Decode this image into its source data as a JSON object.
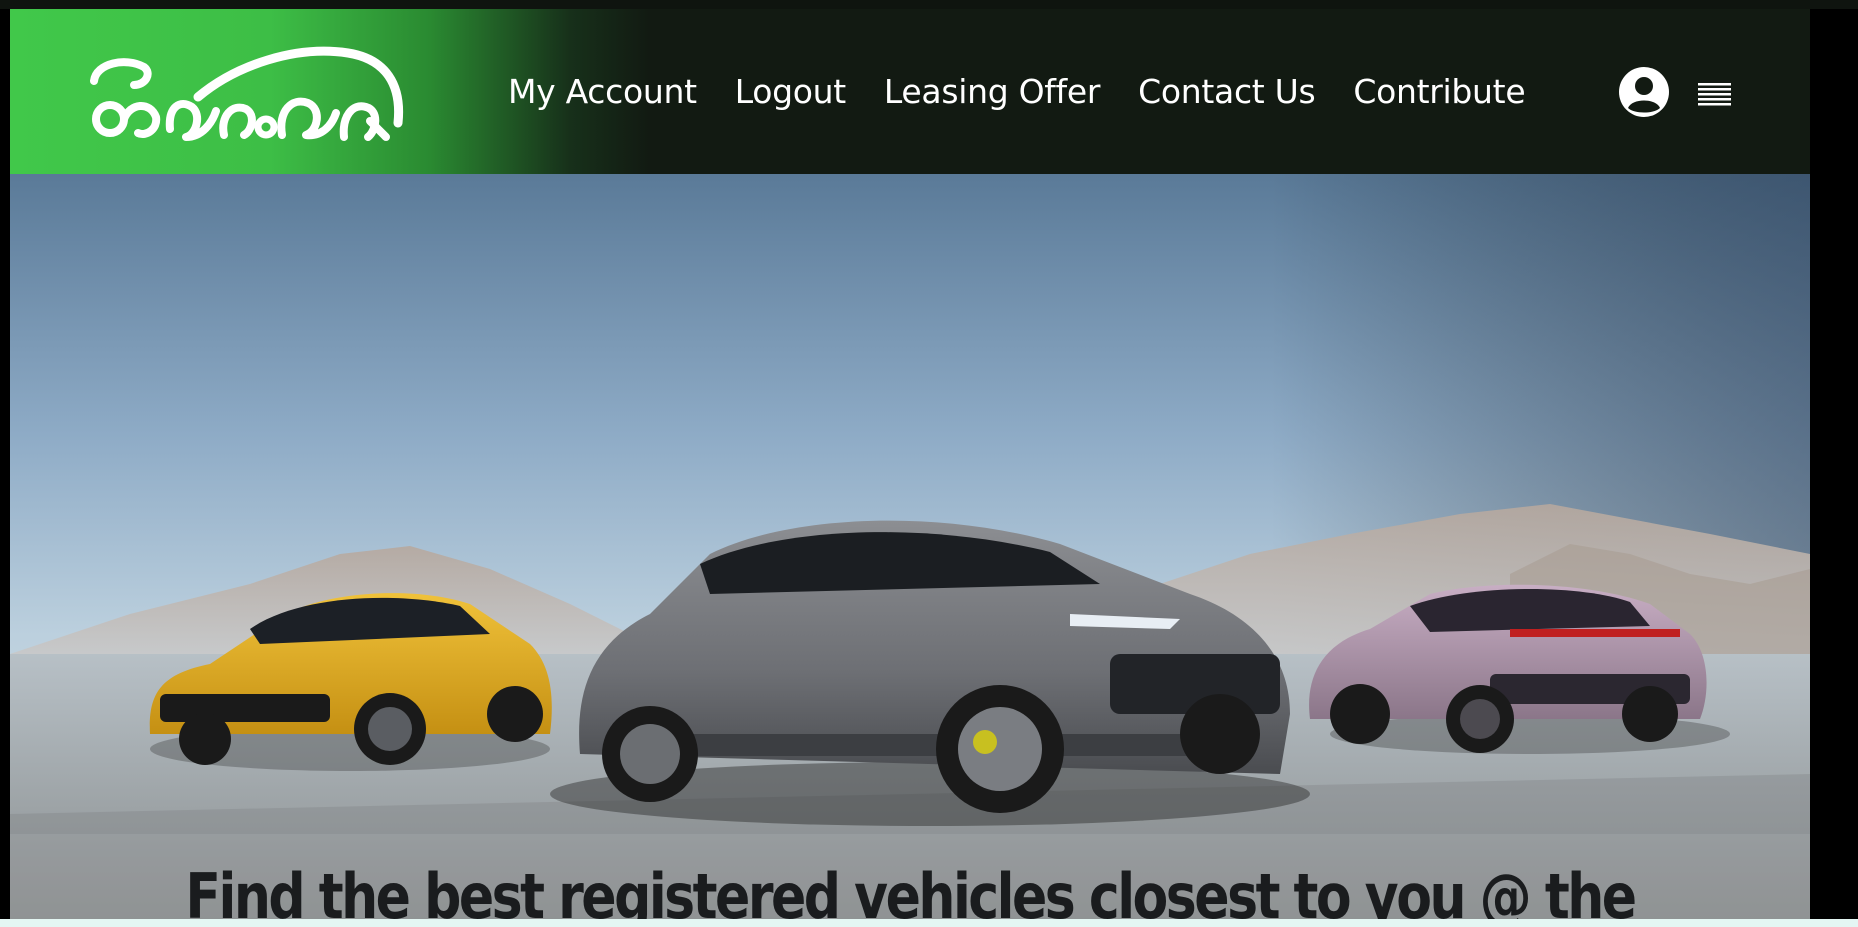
{
  "header": {
    "logo_alt": "රියස්වන",
    "nav": [
      {
        "label": "My Account"
      },
      {
        "label": "Logout"
      },
      {
        "label": "Leasing Offer"
      },
      {
        "label": "Contact Us"
      },
      {
        "label": "Contribute"
      }
    ],
    "icons": {
      "account": "user-circle-icon",
      "menu": "hamburger-menu-icon"
    }
  },
  "hero": {
    "image": "three-suv-cars-mountains",
    "headline": "Find the best registered vehicles closest to you @ the"
  },
  "colors": {
    "brand_green": "#41c84a",
    "header_dark": "#121a12",
    "headline": "#1a1c1e"
  }
}
